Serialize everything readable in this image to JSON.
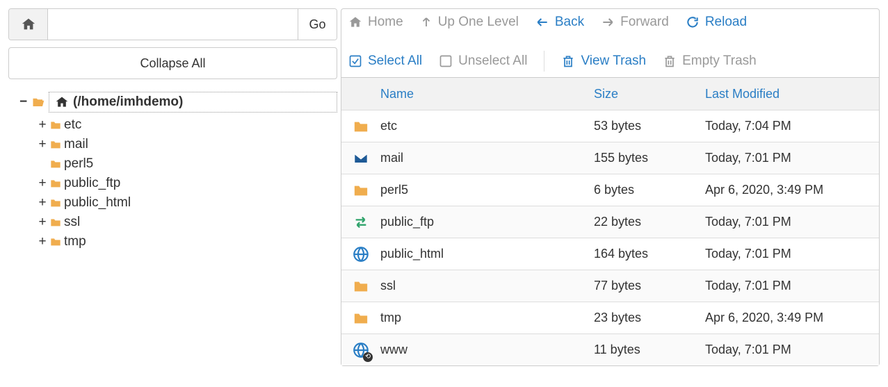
{
  "pathbar": {
    "go_label": "Go",
    "value": ""
  },
  "collapse_all_label": "Collapse All",
  "tree": {
    "root_label": "(/home/imhdemo)",
    "items": [
      {
        "label": "etc",
        "expandable": true
      },
      {
        "label": "mail",
        "expandable": true
      },
      {
        "label": "perl5",
        "expandable": false
      },
      {
        "label": "public_ftp",
        "expandable": true
      },
      {
        "label": "public_html",
        "expandable": true
      },
      {
        "label": "ssl",
        "expandable": true
      },
      {
        "label": "tmp",
        "expandable": true
      }
    ]
  },
  "toolbar": {
    "home": "Home",
    "up": "Up One Level",
    "back": "Back",
    "forward": "Forward",
    "reload": "Reload",
    "select_all": "Select All",
    "unselect_all": "Unselect All",
    "view_trash": "View Trash",
    "empty_trash": "Empty Trash"
  },
  "table": {
    "headers": {
      "name": "Name",
      "size": "Size",
      "modified": "Last Modified"
    },
    "rows": [
      {
        "icon": "folder",
        "name": "etc",
        "size": "53 bytes",
        "modified": "Today, 7:04 PM"
      },
      {
        "icon": "mail",
        "name": "mail",
        "size": "155 bytes",
        "modified": "Today, 7:01 PM"
      },
      {
        "icon": "folder",
        "name": "perl5",
        "size": "6 bytes",
        "modified": "Apr 6, 2020, 3:49 PM"
      },
      {
        "icon": "transfer",
        "name": "public_ftp",
        "size": "22 bytes",
        "modified": "Today, 7:01 PM"
      },
      {
        "icon": "globe",
        "name": "public_html",
        "size": "164 bytes",
        "modified": "Today, 7:01 PM"
      },
      {
        "icon": "folder",
        "name": "ssl",
        "size": "77 bytes",
        "modified": "Today, 7:01 PM"
      },
      {
        "icon": "folder",
        "name": "tmp",
        "size": "23 bytes",
        "modified": "Apr 6, 2020, 3:49 PM"
      },
      {
        "icon": "globe-link",
        "name": "www",
        "size": "11 bytes",
        "modified": "Today, 7:01 PM"
      }
    ]
  },
  "colors": {
    "link": "#2a7ec5",
    "disabled": "#999999",
    "folder": "#f0ad4e",
    "mail": "#1e5a96",
    "transfer": "#2fa36b",
    "globe": "#2a7ec5"
  }
}
